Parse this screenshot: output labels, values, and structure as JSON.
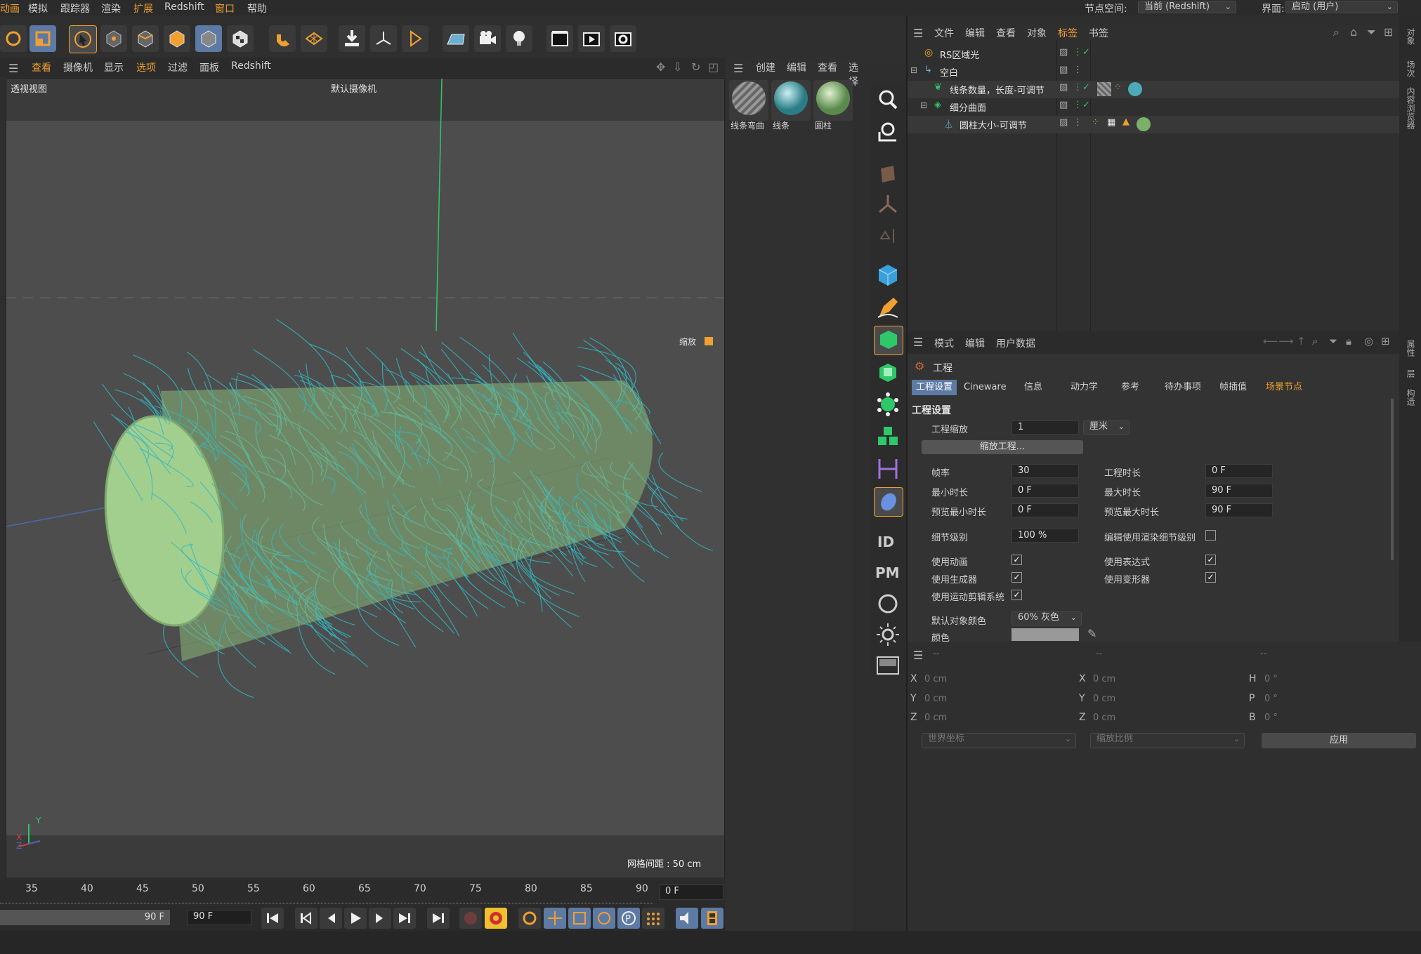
{
  "menu": {
    "items": [
      "动画",
      "模拟",
      "跟踪器",
      "渲染",
      "扩展",
      "Redshift",
      "窗口",
      "帮助"
    ]
  },
  "topright": {
    "node_space_label": "节点空间:",
    "node_space_value": "当前 (Redshift)",
    "layout_label": "界面:",
    "layout_value": "启动 (用户)"
  },
  "viewport": {
    "menu": [
      "查看",
      "摄像机",
      "显示",
      "选项",
      "过滤",
      "面板",
      "Redshift"
    ],
    "name": "透视视图",
    "camera": "默认摄像机",
    "zoom_label": "缩放",
    "grid_spacing": "网格间距 : 50 cm",
    "axis_x": "X",
    "axis_y": "Y",
    "axis_z": "Z"
  },
  "timeline": {
    "ticks": [
      "35",
      "40",
      "45",
      "50",
      "55",
      "60",
      "65",
      "70",
      "75",
      "80",
      "85",
      "90"
    ],
    "current_frame": "0 F",
    "end_frame": "90 F",
    "end_frame2": "90 F"
  },
  "materials": {
    "menu": [
      "创建",
      "编辑",
      "查看",
      "选择"
    ],
    "items": [
      {
        "name": "线条弯曲"
      },
      {
        "name": "线条"
      },
      {
        "name": "圆柱"
      }
    ]
  },
  "sidebar_labels": {
    "id": "ID",
    "pm": "PM"
  },
  "objects": {
    "menu": [
      "文件",
      "编辑",
      "查看",
      "对象",
      "标签",
      "书签"
    ],
    "rows": [
      {
        "name": "RS区域光"
      },
      {
        "name": "空白"
      },
      {
        "name": "线条数量，长度-可调节"
      },
      {
        "name": "细分曲面"
      },
      {
        "name": "圆柱大小-可调节"
      }
    ]
  },
  "right_vertical_tabs": [
    "对象",
    "场次",
    "内容浏览器"
  ],
  "attr_vertical_tabs": [
    "属性",
    "层",
    "构造"
  ],
  "attributes": {
    "menu": [
      "模式",
      "编辑",
      "用户数据"
    ],
    "object_name": "工程",
    "tabs": [
      "工程设置",
      "Cineware",
      "信息",
      "动力学",
      "参考",
      "待办事项",
      "帧插值",
      "场景节点"
    ],
    "section": "工程设置",
    "scale_label": "工程缩放",
    "scale_value": "1",
    "scale_unit": "厘米",
    "scale_button": "缩放工程...",
    "fps_label": "帧率",
    "fps_value": "30",
    "duration_label": "工程时长",
    "duration_value": "0 F",
    "min_label": "最小时长",
    "min_value": "0 F",
    "max_label": "最大时长",
    "max_value": "90 F",
    "pmin_label": "预览最小时长",
    "pmin_value": "0 F",
    "pmax_label": "预览最大时长",
    "pmax_value": "90 F",
    "lod_label": "细节级别",
    "lod_value": "100 %",
    "lod_render_label": "编辑使用渲染细节级别",
    "use_anim": "使用动画",
    "use_expr": "使用表达式",
    "use_gen": "使用生成器",
    "use_deform": "使用变形器",
    "use_motion": "使用运动剪辑系统",
    "default_color_label": "默认对象颜色",
    "default_color_value": "60% 灰色",
    "color_label": "颜色"
  },
  "coords": {
    "header": [
      "--",
      "--",
      "--"
    ],
    "x": "X",
    "y": "Y",
    "z": "Z",
    "h": "H",
    "p": "P",
    "b": "B",
    "pos": [
      "0 cm",
      "0 cm",
      "0 cm"
    ],
    "size": [
      "0 cm",
      "0 cm",
      "0 cm"
    ],
    "rot": [
      "0 °",
      "0 °",
      "0 °"
    ],
    "space": "世界坐标",
    "scale_mode": "缩放比例",
    "apply": "应用"
  },
  "colors": {
    "accent": "#5c7aa3",
    "hair": "#2fb8c4",
    "cylinder": "#a3cf8e",
    "toolbar_orange": "#f0a030"
  }
}
